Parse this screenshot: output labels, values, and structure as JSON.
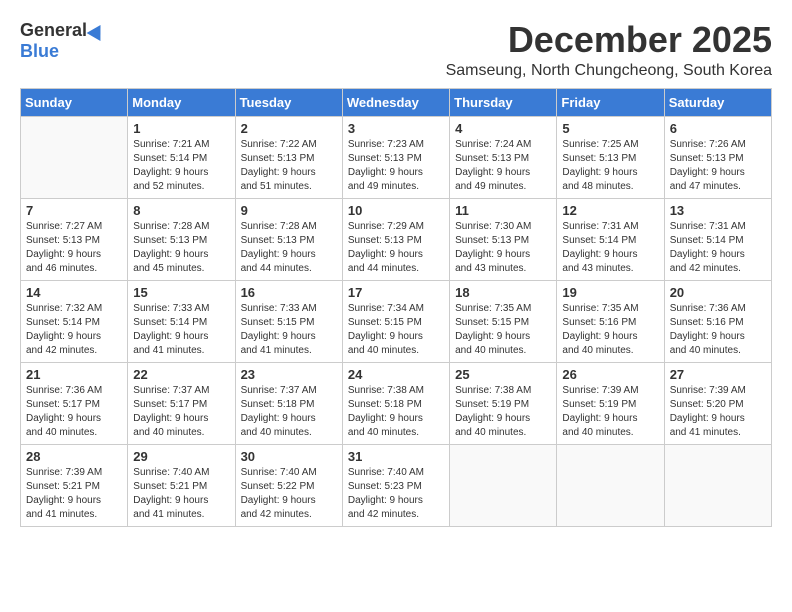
{
  "header": {
    "logo_general": "General",
    "logo_blue": "Blue",
    "month_title": "December 2025",
    "location": "Samseung, North Chungcheong, South Korea"
  },
  "weekdays": [
    "Sunday",
    "Monday",
    "Tuesday",
    "Wednesday",
    "Thursday",
    "Friday",
    "Saturday"
  ],
  "weeks": [
    [
      {
        "day": "",
        "info": ""
      },
      {
        "day": "1",
        "info": "Sunrise: 7:21 AM\nSunset: 5:14 PM\nDaylight: 9 hours\nand 52 minutes."
      },
      {
        "day": "2",
        "info": "Sunrise: 7:22 AM\nSunset: 5:13 PM\nDaylight: 9 hours\nand 51 minutes."
      },
      {
        "day": "3",
        "info": "Sunrise: 7:23 AM\nSunset: 5:13 PM\nDaylight: 9 hours\nand 49 minutes."
      },
      {
        "day": "4",
        "info": "Sunrise: 7:24 AM\nSunset: 5:13 PM\nDaylight: 9 hours\nand 49 minutes."
      },
      {
        "day": "5",
        "info": "Sunrise: 7:25 AM\nSunset: 5:13 PM\nDaylight: 9 hours\nand 48 minutes."
      },
      {
        "day": "6",
        "info": "Sunrise: 7:26 AM\nSunset: 5:13 PM\nDaylight: 9 hours\nand 47 minutes."
      }
    ],
    [
      {
        "day": "7",
        "info": "Sunrise: 7:27 AM\nSunset: 5:13 PM\nDaylight: 9 hours\nand 46 minutes."
      },
      {
        "day": "8",
        "info": "Sunrise: 7:28 AM\nSunset: 5:13 PM\nDaylight: 9 hours\nand 45 minutes."
      },
      {
        "day": "9",
        "info": "Sunrise: 7:28 AM\nSunset: 5:13 PM\nDaylight: 9 hours\nand 44 minutes."
      },
      {
        "day": "10",
        "info": "Sunrise: 7:29 AM\nSunset: 5:13 PM\nDaylight: 9 hours\nand 44 minutes."
      },
      {
        "day": "11",
        "info": "Sunrise: 7:30 AM\nSunset: 5:13 PM\nDaylight: 9 hours\nand 43 minutes."
      },
      {
        "day": "12",
        "info": "Sunrise: 7:31 AM\nSunset: 5:14 PM\nDaylight: 9 hours\nand 43 minutes."
      },
      {
        "day": "13",
        "info": "Sunrise: 7:31 AM\nSunset: 5:14 PM\nDaylight: 9 hours\nand 42 minutes."
      }
    ],
    [
      {
        "day": "14",
        "info": "Sunrise: 7:32 AM\nSunset: 5:14 PM\nDaylight: 9 hours\nand 42 minutes."
      },
      {
        "day": "15",
        "info": "Sunrise: 7:33 AM\nSunset: 5:14 PM\nDaylight: 9 hours\nand 41 minutes."
      },
      {
        "day": "16",
        "info": "Sunrise: 7:33 AM\nSunset: 5:15 PM\nDaylight: 9 hours\nand 41 minutes."
      },
      {
        "day": "17",
        "info": "Sunrise: 7:34 AM\nSunset: 5:15 PM\nDaylight: 9 hours\nand 40 minutes."
      },
      {
        "day": "18",
        "info": "Sunrise: 7:35 AM\nSunset: 5:15 PM\nDaylight: 9 hours\nand 40 minutes."
      },
      {
        "day": "19",
        "info": "Sunrise: 7:35 AM\nSunset: 5:16 PM\nDaylight: 9 hours\nand 40 minutes."
      },
      {
        "day": "20",
        "info": "Sunrise: 7:36 AM\nSunset: 5:16 PM\nDaylight: 9 hours\nand 40 minutes."
      }
    ],
    [
      {
        "day": "21",
        "info": "Sunrise: 7:36 AM\nSunset: 5:17 PM\nDaylight: 9 hours\nand 40 minutes."
      },
      {
        "day": "22",
        "info": "Sunrise: 7:37 AM\nSunset: 5:17 PM\nDaylight: 9 hours\nand 40 minutes."
      },
      {
        "day": "23",
        "info": "Sunrise: 7:37 AM\nSunset: 5:18 PM\nDaylight: 9 hours\nand 40 minutes."
      },
      {
        "day": "24",
        "info": "Sunrise: 7:38 AM\nSunset: 5:18 PM\nDaylight: 9 hours\nand 40 minutes."
      },
      {
        "day": "25",
        "info": "Sunrise: 7:38 AM\nSunset: 5:19 PM\nDaylight: 9 hours\nand 40 minutes."
      },
      {
        "day": "26",
        "info": "Sunrise: 7:39 AM\nSunset: 5:19 PM\nDaylight: 9 hours\nand 40 minutes."
      },
      {
        "day": "27",
        "info": "Sunrise: 7:39 AM\nSunset: 5:20 PM\nDaylight: 9 hours\nand 41 minutes."
      }
    ],
    [
      {
        "day": "28",
        "info": "Sunrise: 7:39 AM\nSunset: 5:21 PM\nDaylight: 9 hours\nand 41 minutes."
      },
      {
        "day": "29",
        "info": "Sunrise: 7:40 AM\nSunset: 5:21 PM\nDaylight: 9 hours\nand 41 minutes."
      },
      {
        "day": "30",
        "info": "Sunrise: 7:40 AM\nSunset: 5:22 PM\nDaylight: 9 hours\nand 42 minutes."
      },
      {
        "day": "31",
        "info": "Sunrise: 7:40 AM\nSunset: 5:23 PM\nDaylight: 9 hours\nand 42 minutes."
      },
      {
        "day": "",
        "info": ""
      },
      {
        "day": "",
        "info": ""
      },
      {
        "day": "",
        "info": ""
      }
    ]
  ]
}
